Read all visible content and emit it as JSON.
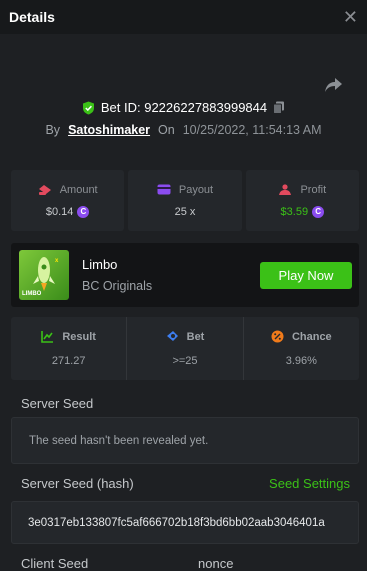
{
  "header": {
    "title": "Details"
  },
  "bet": {
    "id_label": "Bet ID: 92226227883999844",
    "by_label": "By",
    "username": "Satoshimaker",
    "on_label": "On",
    "datetime": "10/25/2022, 11:54:13 AM"
  },
  "stats": {
    "amount": {
      "label": "Amount",
      "value": "$0.14"
    },
    "payout": {
      "label": "Payout",
      "value": "25 x"
    },
    "profit": {
      "label": "Profit",
      "value": "$3.59"
    }
  },
  "game": {
    "name": "Limbo",
    "provider": "BC Originals",
    "thumb_text": "LIMBO",
    "play_label": "Play Now"
  },
  "result": {
    "result": {
      "label": "Result",
      "value": "271.27"
    },
    "bet": {
      "label": "Bet",
      "value": ">=25"
    },
    "chance": {
      "label": "Chance",
      "value": "3.96%"
    }
  },
  "seeds": {
    "server_label": "Server Seed",
    "server_value": "The seed hasn't been revealed yet.",
    "hash_label": "Server Seed (hash)",
    "settings_label": "Seed Settings",
    "hash_value": "3e0317eb133807fc5af666702b18f3bd6bb02aab3046401a",
    "client_label": "Client Seed",
    "nonce_label": "nonce"
  },
  "colors": {
    "accent_green": "#3bc117",
    "coin_purple": "#8b4cf0",
    "background": "#1e2023",
    "panel": "#24272b"
  }
}
